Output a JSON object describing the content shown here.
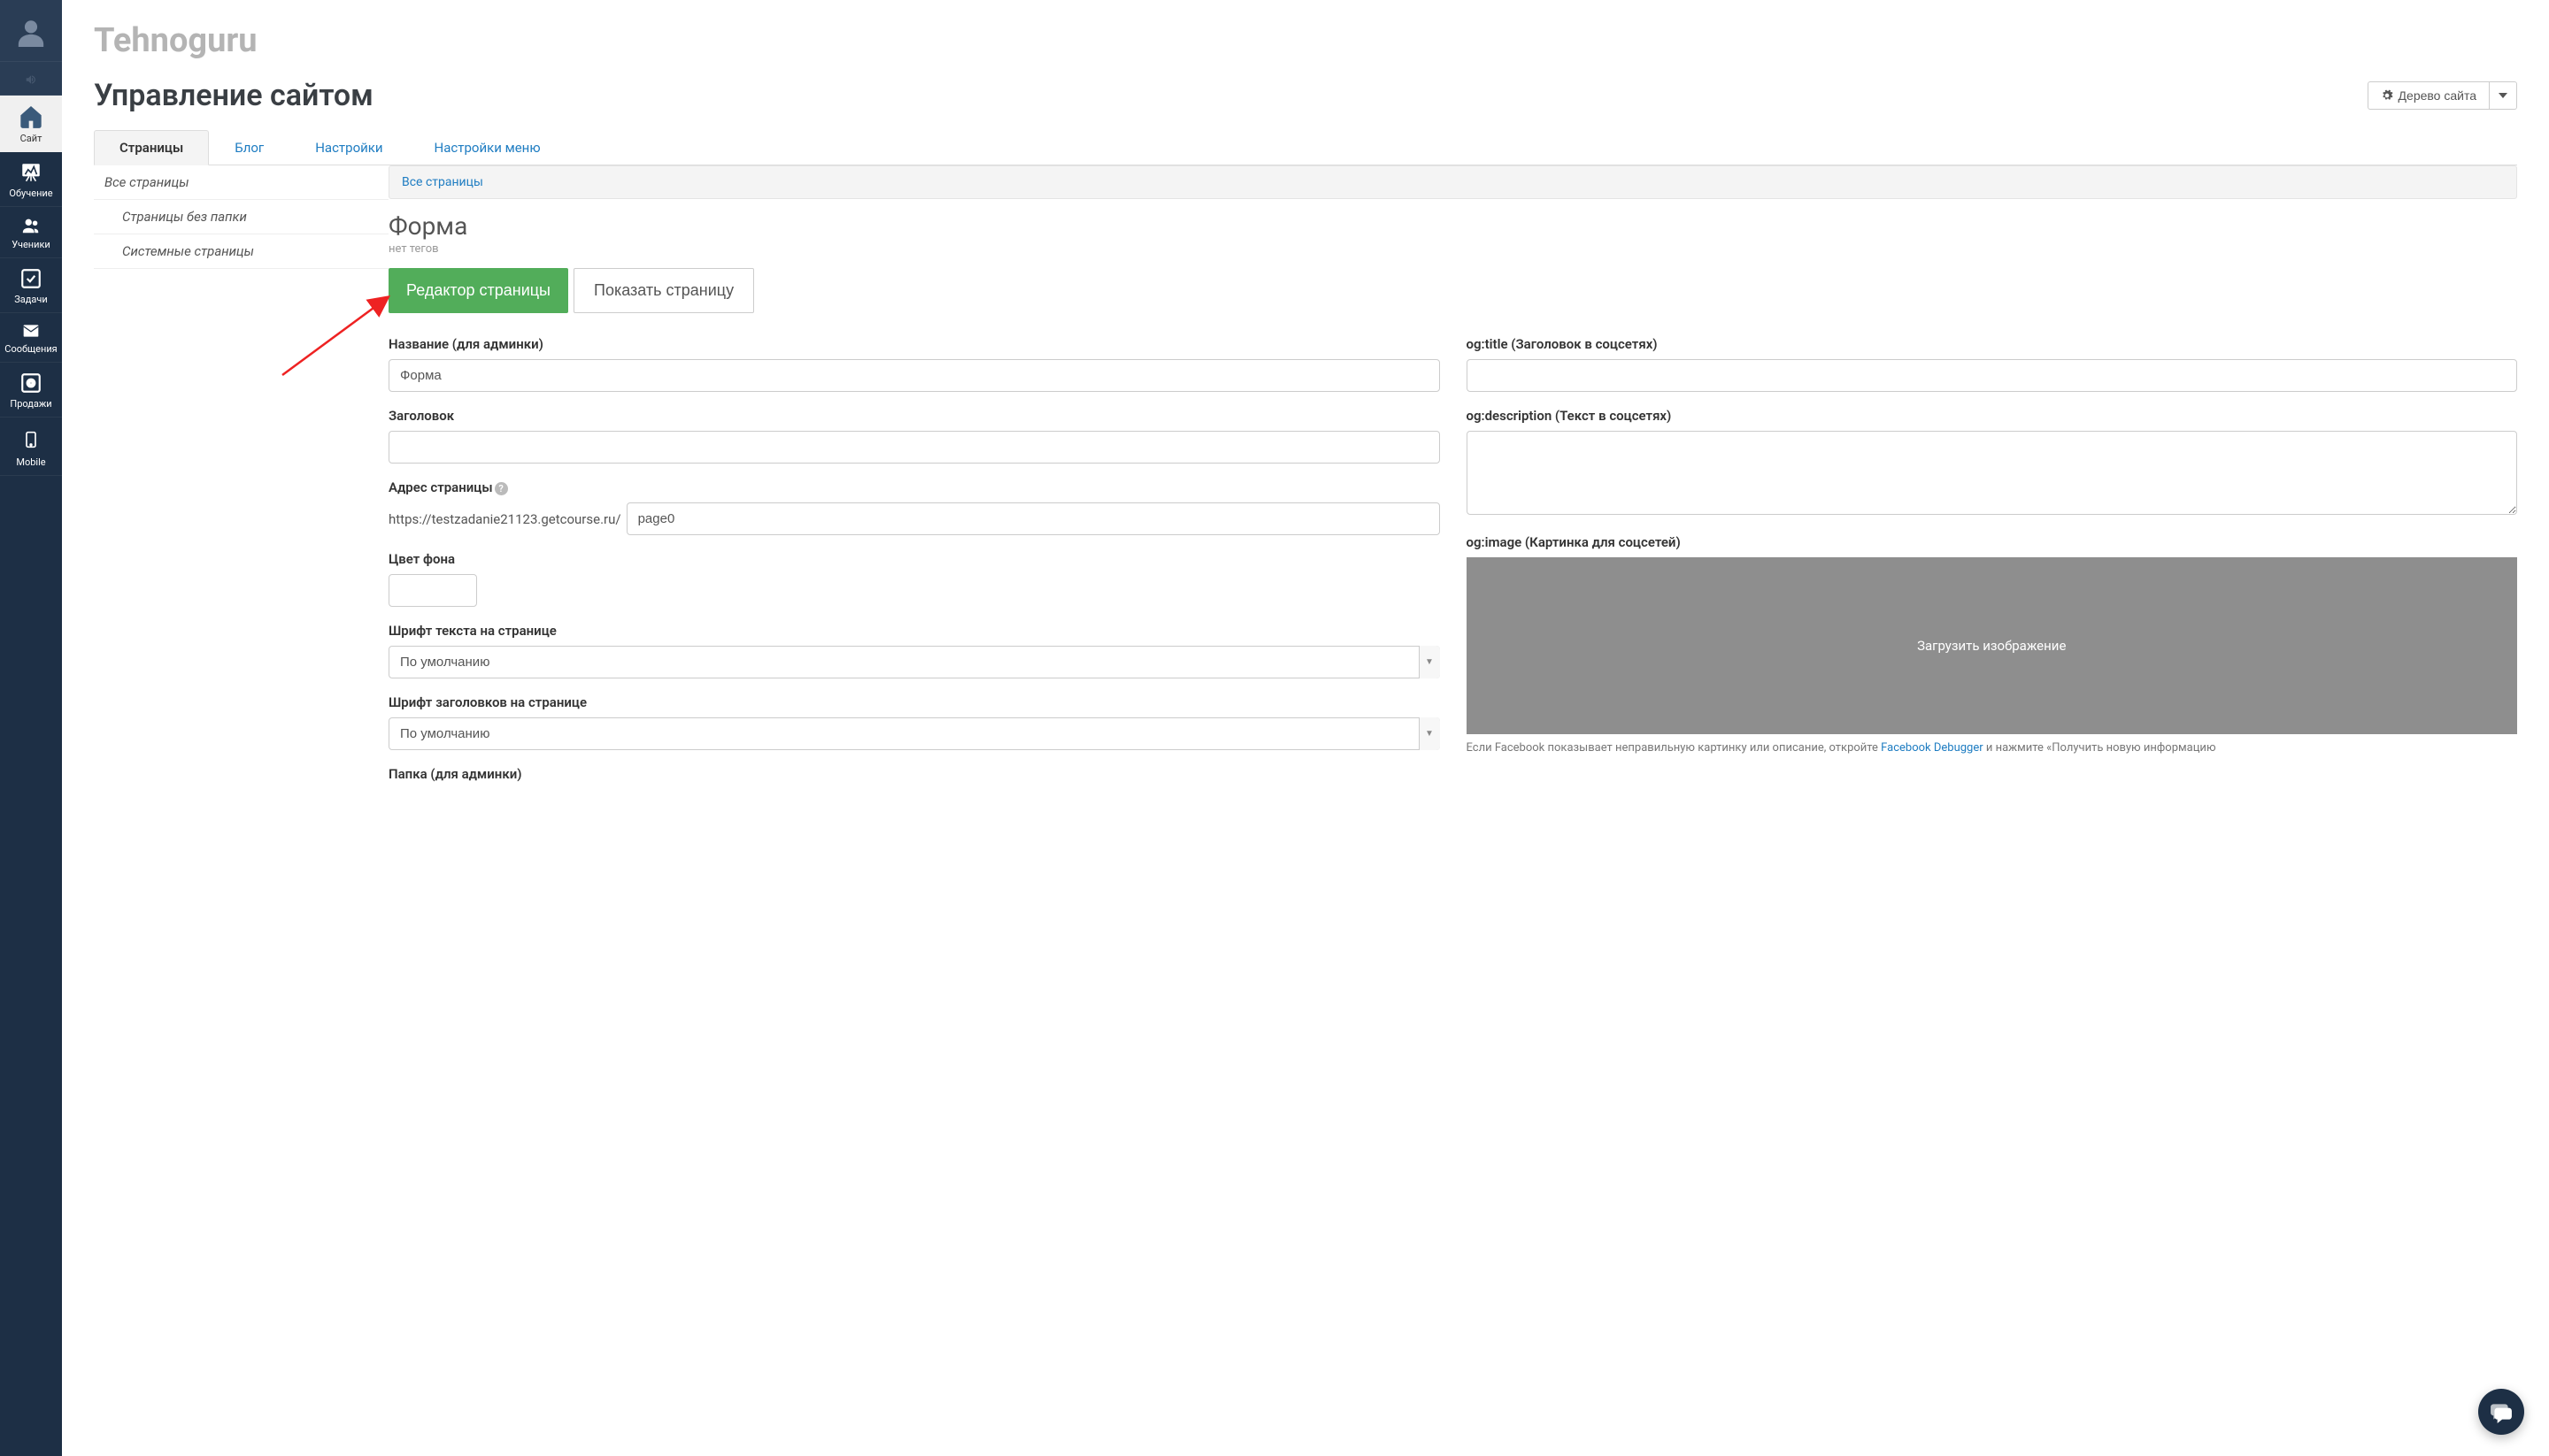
{
  "sidebar": {
    "items": [
      {
        "label": "Сайт"
      },
      {
        "label": "Обучение"
      },
      {
        "label": "Ученики"
      },
      {
        "label": "Задачи"
      },
      {
        "label": "Сообщения"
      },
      {
        "label": "Продажи"
      },
      {
        "label": "Mobile"
      }
    ]
  },
  "brand": "Tehnoguru",
  "page_title": "Управление сайтом",
  "tree_button": "Дерево сайта",
  "tabs": [
    {
      "label": "Страницы"
    },
    {
      "label": "Блог"
    },
    {
      "label": "Настройки"
    },
    {
      "label": "Настройки меню"
    }
  ],
  "page_tree": {
    "all": "Все страницы",
    "nofolder": "Страницы без папки",
    "system": "Системные страницы"
  },
  "breadcrumb": "Все страницы",
  "form": {
    "heading": "Форма",
    "no_tags": "нет тегов",
    "editor_btn": "Редактор страницы",
    "show_btn": "Показать страницу",
    "name_label": "Название (для админки)",
    "name_value": "Форма",
    "title_label": "Заголовок",
    "title_value": "",
    "url_label": "Адрес страницы",
    "url_prefix": "https://testzadanie21123.getcourse.ru/",
    "url_value": "page0",
    "bgcolor_label": "Цвет фона",
    "bgcolor_value": "",
    "font_text_label": "Шрифт текста на странице",
    "font_text_value": "По умолчанию",
    "font_head_label": "Шрифт заголовков на странице",
    "font_head_value": "По умолчанию",
    "folder_label": "Папка (для админки)",
    "og_title_label": "og:title (Заголовок в соцсетях)",
    "og_title_value": "",
    "og_desc_label": "og:description (Текст в соцсетях)",
    "og_desc_value": "",
    "og_image_label": "og:image (Картинка для соцсетей)",
    "og_image_upload": "Загрузить изображение",
    "og_note_1": "Если Facebook показывает неправильную картинку или описание, откройте ",
    "og_note_link": "Facebook Debugger",
    "og_note_2": " и нажмите «Получить новую информацию"
  }
}
